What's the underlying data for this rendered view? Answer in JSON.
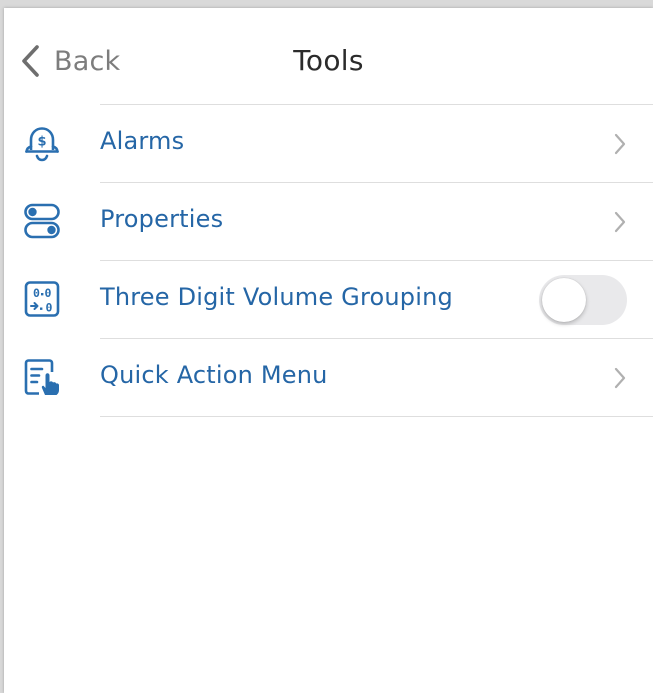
{
  "nav": {
    "back_label": "Back",
    "title": "Tools"
  },
  "items": [
    {
      "label": "Alarms",
      "icon": "alarm-bell-dollar-icon",
      "accessory": "chevron"
    },
    {
      "label": "Properties",
      "icon": "properties-toggles-icon",
      "accessory": "chevron"
    },
    {
      "label": "Three Digit Volume Grouping",
      "icon": "volume-grouping-icon",
      "accessory": "toggle",
      "toggle_on": false
    },
    {
      "label": "Quick Action Menu",
      "icon": "quick-action-menu-icon",
      "accessory": "chevron"
    }
  ],
  "colors": {
    "accent": "#2566a6",
    "icon": "#2a6fb0",
    "back_text": "#7d7d7d",
    "title_text": "#2b2b2b",
    "chevron": "#b0b0b0",
    "separator": "#dedede",
    "toggle_off": "#e9e9eb"
  }
}
